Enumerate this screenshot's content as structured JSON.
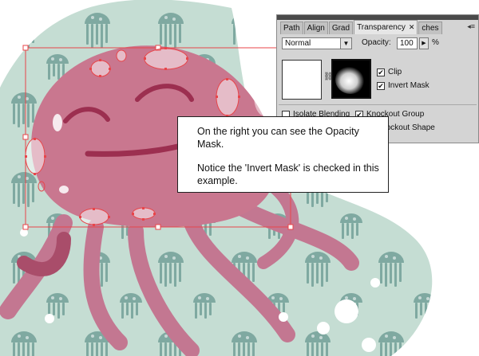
{
  "panel": {
    "tabs": [
      "Path",
      "Align",
      "Grad",
      "Transparency",
      "ches"
    ],
    "active_tab_index": 3,
    "blend_mode": "Normal",
    "opacity_label": "Opacity:",
    "opacity_value": "100",
    "opacity_unit": "%",
    "checkboxes": {
      "clip": {
        "label": "Clip",
        "checked": true
      },
      "invert_mask": {
        "label": "Invert Mask",
        "checked": true
      },
      "isolate_blending": {
        "label": "Isolate Blending",
        "checked": false
      },
      "knockout_group": {
        "label": "Knockout Group",
        "checked": true
      },
      "opacity_knockout_shape": {
        "label": "Opacity & Mask Define Knockout Shape",
        "checked": false
      }
    }
  },
  "callout": {
    "line1": "On the right you can see the Opacity Mask.",
    "line2": "Notice the 'Invert Mask' is checked in this example."
  },
  "colors": {
    "pattern_bg": "#c9e0d6",
    "jellyfish_pink": "#c9778f",
    "tentacle": "#b75f7a",
    "selection": "#e8454a",
    "panel_bg": "#d4d4d4"
  }
}
